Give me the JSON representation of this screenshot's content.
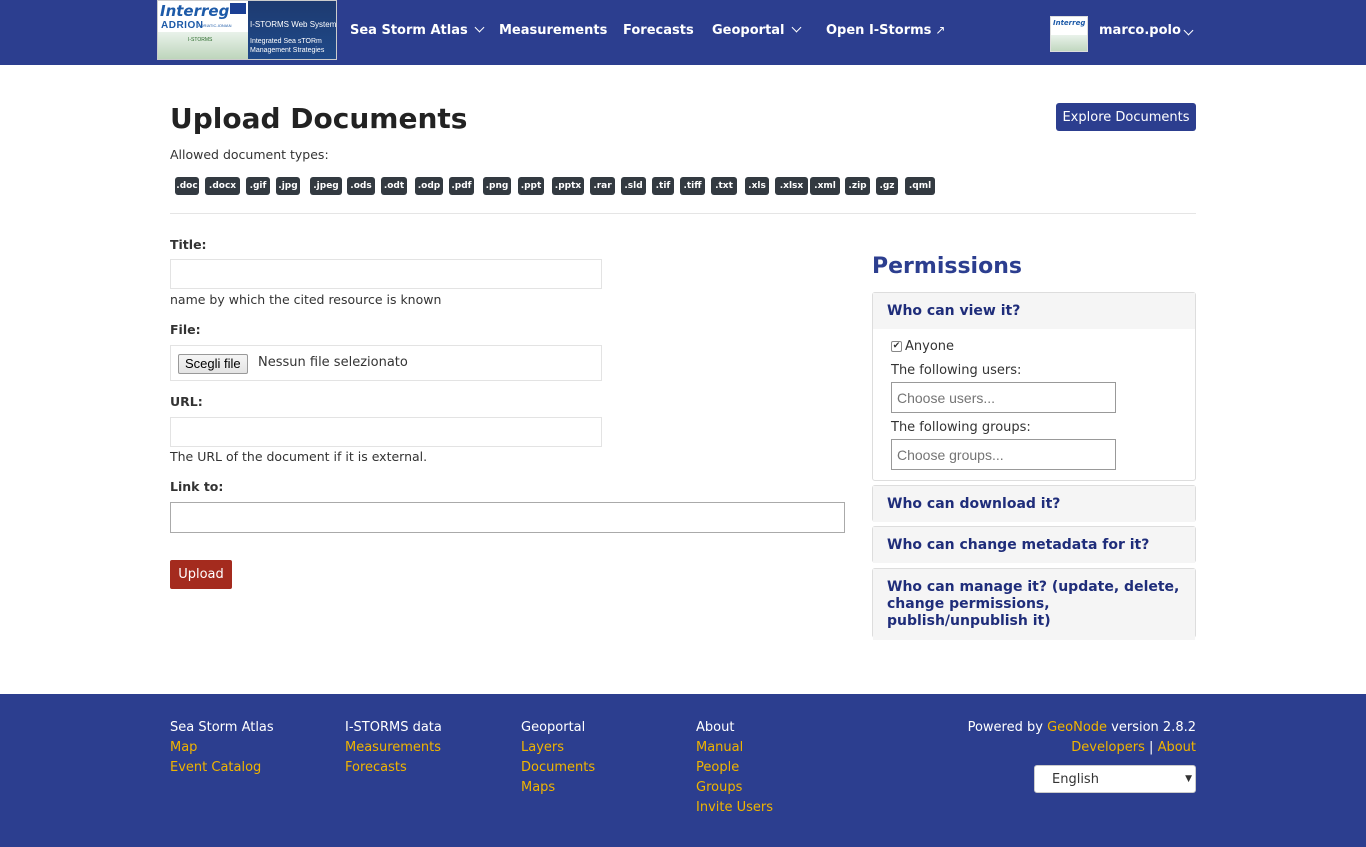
{
  "nav": {
    "logo": {
      "interreg": "Interreg",
      "adrion": "ADRION",
      "adriatic_ionian": "ADRIATIC-IONIAN",
      "istorms": "I-STORMS",
      "system": "I-STORMS Web System",
      "line2": "Integrated Sea sTORm",
      "line3": "Management Strategies"
    },
    "items": [
      {
        "label": "Sea Storm Atlas",
        "dropdown": true
      },
      {
        "label": "Measurements",
        "dropdown": false
      },
      {
        "label": "Forecasts",
        "dropdown": false
      },
      {
        "label": "Geoportal",
        "dropdown": true
      },
      {
        "label": "Open I-Storms",
        "external": true
      }
    ],
    "user": "marco.polo"
  },
  "page": {
    "title": "Upload Documents",
    "explore_button": "Explore Documents",
    "allowed_label": "Allowed document types:",
    "types": [
      ".doc",
      ".docx",
      ".gif",
      ".jpg",
      ".jpeg",
      ".ods",
      ".odt",
      ".odp",
      ".pdf",
      ".png",
      ".ppt",
      ".pptx",
      ".rar",
      ".sld",
      ".tif",
      ".tiff",
      ".txt",
      ".xls",
      ".xlsx",
      ".xml",
      ".zip",
      ".gz",
      ".qml"
    ]
  },
  "form": {
    "title_label": "Title:",
    "title_value": "",
    "title_help": "name by which the cited resource is known",
    "file_label": "File:",
    "file_button": "Scegli file",
    "file_status": "Nessun file selezionato",
    "url_label": "URL:",
    "url_value": "",
    "url_help": "The URL of the document if it is external.",
    "link_label": "Link to:",
    "link_value": "",
    "upload_button": "Upload"
  },
  "permissions": {
    "title": "Permissions",
    "view": {
      "heading": "Who can view it?",
      "anyone_label": "Anyone",
      "anyone_checked": true,
      "users_label": "The following users:",
      "users_placeholder": "Choose users...",
      "groups_label": "The following groups:",
      "groups_placeholder": "Choose groups..."
    },
    "download_heading": "Who can download it?",
    "metadata_heading": "Who can change metadata for it?",
    "manage_heading": "Who can manage it? (update, delete, change permissions, publish/unpublish it)"
  },
  "footer": {
    "col1": {
      "head": "Sea Storm Atlas",
      "links": [
        "Map",
        "Event Catalog"
      ]
    },
    "col2": {
      "head": "I-STORMS data",
      "links": [
        "Measurements",
        "Forecasts"
      ]
    },
    "col3": {
      "head": "Geoportal",
      "links": [
        "Layers",
        "Documents",
        "Maps"
      ]
    },
    "col4": {
      "head": "About",
      "links": [
        "Manual",
        "People",
        "Groups",
        "Invite Users"
      ]
    },
    "powered_prefix": "Powered by",
    "geonode": "GeoNode",
    "version": "version 2.8.2",
    "developers": "Developers",
    "separator": "|",
    "about": "About",
    "language": "English"
  },
  "colors": {
    "nav_bg": "#2c3e8f",
    "footer_link": "#f0b400",
    "upload_btn": "#a42b1e",
    "badge": "#333a41"
  }
}
